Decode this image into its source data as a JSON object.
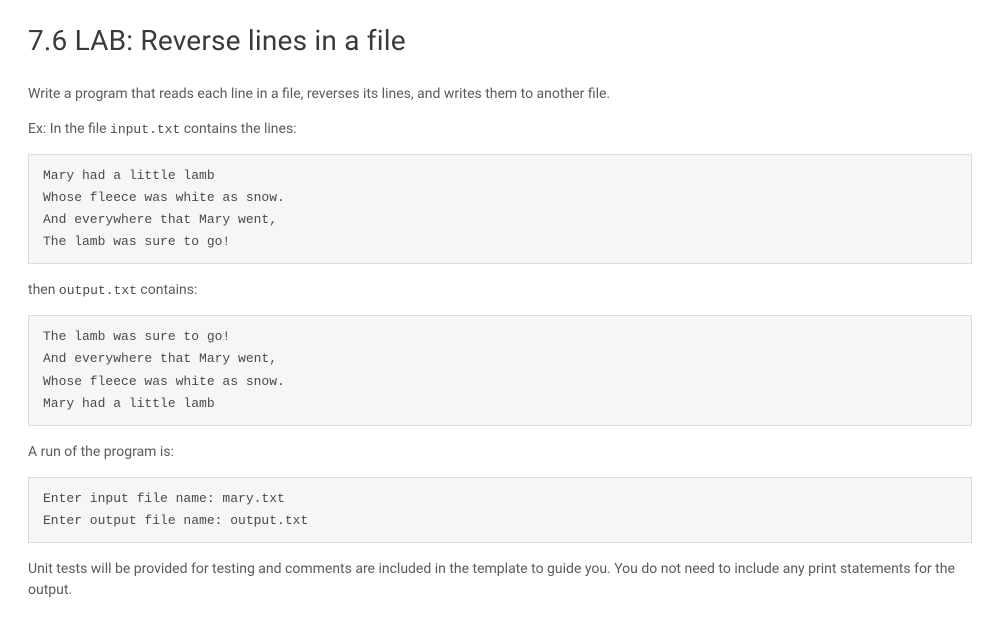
{
  "title": "7.6 LAB: Reverse lines in a file",
  "intro": "Write a program that reads each line in a file, reverses its lines, and writes them to another file.",
  "example_label_pre": "Ex: In the file ",
  "example_filename": "input.txt",
  "example_label_post": " contains the lines:",
  "input_block": "Mary had a little lamb\nWhose fleece was white as snow.\nAnd everywhere that Mary went,\nThe lamb was sure to go!",
  "then_label_pre": "then ",
  "then_filename": "output.txt",
  "then_label_post": " contains:",
  "output_block": "The lamb was sure to go!\nAnd everywhere that Mary went,\nWhose fleece was white as snow.\nMary had a little lamb",
  "run_label": "A run of the program is:",
  "run_block": "Enter input file name: mary.txt\nEnter output file name: output.txt",
  "unit_test_note": "Unit tests will be provided for testing and comments are included in the template to guide you. You do not need to include any print statements for the output."
}
